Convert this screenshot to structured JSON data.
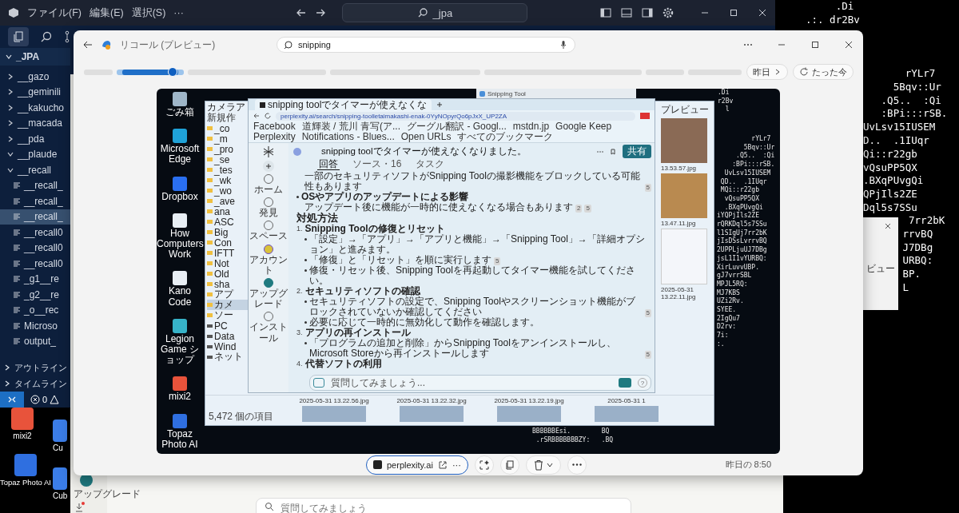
{
  "vscode": {
    "menu": [
      "ファイル(F)",
      "編集(E)",
      "選択(S)",
      "···"
    ],
    "search": "_jpa",
    "root": "_JPA",
    "tree": [
      {
        "label": "__gazo",
        "kind": "folder",
        "expanded": false,
        "selected": false
      },
      {
        "label": "__geminili",
        "kind": "folder",
        "expanded": false,
        "selected": false
      },
      {
        "label": "__kakucho",
        "kind": "folder",
        "expanded": false,
        "selected": false
      },
      {
        "label": "__macada",
        "kind": "folder",
        "expanded": false,
        "selected": false
      },
      {
        "label": "__pda",
        "kind": "folder",
        "expanded": false,
        "selected": false
      },
      {
        "label": "__plaude",
        "kind": "folder",
        "expanded": true,
        "selected": false
      },
      {
        "label": "__recall",
        "kind": "folder",
        "expanded": true,
        "selected": false,
        "children": [
          {
            "label": "__recall_",
            "kind": "file",
            "selected": false
          },
          {
            "label": "__recall_",
            "kind": "file",
            "selected": false
          },
          {
            "label": "__recall_",
            "kind": "file",
            "selected": true
          },
          {
            "label": "__recall0",
            "kind": "file",
            "selected": false
          },
          {
            "label": "__recall0",
            "kind": "file",
            "selected": false
          },
          {
            "label": "__recall0",
            "kind": "file",
            "selected": false
          },
          {
            "label": "_g1__re",
            "kind": "file",
            "selected": false
          },
          {
            "label": "_g2__re",
            "kind": "file",
            "selected": false
          },
          {
            "label": "_o__rec",
            "kind": "file",
            "selected": false
          },
          {
            "label": "Microso",
            "kind": "file",
            "selected": false
          },
          {
            "label": "output_",
            "kind": "file",
            "selected": false
          }
        ]
      }
    ],
    "panels": [
      {
        "label": "アウトライン",
        "expanded": false
      },
      {
        "label": "タイムライン",
        "expanded": false
      }
    ],
    "errors": "0"
  },
  "terminal": {
    "top_lines": [
      "     .Di",
      ".:. dr2Bv"
    ],
    "lines": [
      "       rYLr7",
      "     5Bqv::Ur",
      "   .Q5..  :Qi",
      "   :BPi:::rSB.",
      "UvLsv15IUSEM",
      "D..  .1IUqr",
      "Qi::r22gb",
      "vQsuPP5QX",
      ".BXqPUvgQi",
      "QPjIls2ZE",
      "Dql5s7SSu"
    ],
    "covered_lines": [
      "  7rr2bK",
      " rrvBQ",
      " J7DBg",
      " URBQ:",
      " BP.",
      " L"
    ]
  },
  "side_window": {
    "label": "ビュー"
  },
  "desktop_icons": [
    {
      "label": "mixi2",
      "color": "#e8533b"
    },
    {
      "label": "Cu",
      "color": "#3b7de8"
    },
    {
      "label": "Topaz Photo AI",
      "color": "#2f6fe0"
    },
    {
      "label": "Cub",
      "color": "#3b7de8"
    }
  ],
  "background_app": {
    "upgrade": "アップグレード",
    "placeholder": "質問してみましょう"
  },
  "recall": {
    "title": "リコール (プレビュー)",
    "search": "snipping",
    "timeline": [
      {
        "selected": false
      },
      {
        "selected": true,
        "level": 0.83
      },
      {
        "selected": false
      },
      {
        "selected": false
      },
      {
        "selected": false
      },
      {
        "selected": false
      },
      {
        "selected": false
      }
    ],
    "nav_buttons": [
      {
        "label": "昨日",
        "kind": "prev"
      },
      {
        "label": "たった今",
        "kind": "now"
      }
    ],
    "source": "perplexity.ai",
    "more": "···",
    "time": "昨日の 8:50",
    "snapshot": {
      "desktop_icons": [
        {
          "label": "ごみ箱",
          "color": "#9fb6c8"
        },
        {
          "label": "Microsoft Edge",
          "color": "#1fa2d8"
        },
        {
          "label": "Dropbox",
          "color": "#2a6ff0"
        },
        {
          "label": "How Computers Work",
          "color": "#e8eef4"
        },
        {
          "label": "Kano Code",
          "color": "#e8eef4"
        },
        {
          "label": "Legion Game ショップ",
          "color": "#37b3c8"
        },
        {
          "label": "mixi2",
          "color": "#e8533b"
        },
        {
          "label": "Topaz Photo AI",
          "color": "#2f6fe0"
        }
      ],
      "explorer": {
        "title": "カメラア",
        "new": "新規作",
        "folders": [
          {
            "label": "_co",
            "selected": false
          },
          {
            "label": "_m",
            "selected": false
          },
          {
            "label": "_pro",
            "selected": false
          },
          {
            "label": "_se",
            "selected": false
          },
          {
            "label": "_tes",
            "selected": false
          },
          {
            "label": "_wk",
            "selected": false
          },
          {
            "label": "_wo",
            "selected": false
          },
          {
            "label": "_ave",
            "selected": false
          },
          {
            "label": "ana",
            "selected": false
          },
          {
            "label": "ASC",
            "selected": false
          },
          {
            "label": "Big",
            "selected": false
          },
          {
            "label": "Con",
            "selected": false
          },
          {
            "label": "IFTT",
            "selected": false
          },
          {
            "label": "Not",
            "selected": false
          },
          {
            "label": "Old",
            "selected": false
          },
          {
            "label": "sha",
            "selected": false
          },
          {
            "label": "アプ",
            "selected": false
          },
          {
            "label": "カメ",
            "selected": true
          },
          {
            "label": "ソー",
            "selected": false
          }
        ],
        "drives": [
          {
            "label": "PC",
            "selected": false
          },
          {
            "label": "Data",
            "selected": false
          },
          {
            "label": "Wind",
            "selected": false
          },
          {
            "label": "ネット",
            "selected": false
          }
        ],
        "status": "5,472 個の項目",
        "preview": "プレビュー",
        "side_captions": [
          "13.53.57.jpg",
          "13.47.11.jpg",
          "2025-05-31 13.22.11.jpg"
        ],
        "bottom_captions": [
          "2025-05-31 13.22.56.jpg",
          "2025-05-31 13.22.32.jpg",
          "2025-05-31 13.22.19.jpg",
          "2025-05-31 1"
        ]
      },
      "snipping_title": "Snipping Tool",
      "browser": {
        "tab": "snipping toolでタイマーが使えなくな",
        "url": "perplexity.ai/search/snipping-toolletaimakashi-enak-0YyNOpyrQo6pJxX_UP2ZA",
        "bookmarks": [
          "Facebook",
          "道輝装 / 荒川 青写(ア...",
          "グーグル翻訳 - Googl...",
          "mstdn.jp",
          "Google Keep",
          "Perplexity",
          "Notifications - Blues...",
          "Open URLs",
          "すべてのブックマーク"
        ],
        "rail": [
          "ホーム",
          "発見",
          "スペース",
          "アカウント",
          "アップグレード",
          "インストール"
        ],
        "question": "snipping toolでタイマーが使えなくなりました。",
        "share": "共有",
        "tabs": [
          {
            "label": "回答",
            "selected": true
          },
          {
            "label": "ソース・16",
            "selected": false
          },
          {
            "label": "タスク",
            "selected": false
          }
        ],
        "content": [
          {
            "kind": "para",
            "text": "一部のセキュリティソフトがSnipping Toolの撮影機能をブロックしている可能性もあります",
            "cites": [
              "5"
            ]
          },
          {
            "kind": "bullet",
            "text": "OSやアプリのアップデートによる影響"
          },
          {
            "kind": "para",
            "text": "アップデート後に機能が一時的に使えなくなる場合もあります",
            "cites": [
              "2",
              "5"
            ]
          },
          {
            "kind": "heading",
            "text": "対処方法"
          },
          {
            "kind": "step",
            "num": "1.",
            "text": "Snipping Toolの修復とリセット"
          },
          {
            "kind": "sub",
            "text": "「設定」→「アプリ」→「アプリと機能」→「Snipping Tool」→「詳細オプション」と進みます。"
          },
          {
            "kind": "sub",
            "text": "「修復」と「リセット」を順に実行します",
            "cites": [
              "5"
            ]
          },
          {
            "kind": "sub",
            "text": "修復・リセット後、Snipping Toolを再起動してタイマー機能を試してください。"
          },
          {
            "kind": "step",
            "num": "2.",
            "text": "セキュリティソフトの確認"
          },
          {
            "kind": "sub",
            "text": "セキュリティソフトの設定で、Snipping Toolやスクリーンショット機能がブロックされていないか確認してください",
            "cites": [
              "5"
            ]
          },
          {
            "kind": "sub",
            "text": "必要に応じて一時的に無効化して動作を確認します。"
          },
          {
            "kind": "step",
            "num": "3.",
            "text": "アプリの再インストール"
          },
          {
            "kind": "sub",
            "text": "「プログラムの追加と削除」からSnipping Toolをアンインストールし、Microsoft Storeから再インストールします",
            "cites": [
              "5"
            ]
          },
          {
            "kind": "step",
            "num": "4.",
            "text": "代替ソフトの利用"
          }
        ],
        "placeholder": "質問してみましょう...",
        "help": "?"
      },
      "ascii_top": [
        ".Di",
        "r2Bv",
        "  l"
      ],
      "ascii": [
        "         rYLr7",
        "       5Bqv::Ur",
        "     .Q5..  :Qi",
        "    :BPi:::rSB.",
        "  UvLsv15IUSEM",
        " QD..  .1IUqr",
        " MQi::r22gb",
        "  vQsuPP5QX",
        "  .BXqPUvgQi",
        "iYQPjIls2ZE",
        "rQRKDql5s7SSu",
        "l1SIgUj7rr2bK",
        "jIsDSsLvrrvBQ",
        "2UPPLjuUJ7DBg",
        "jsL1I1vYURBQ:",
        "XirLuvvUBP.",
        "gJ7vrrSBL",
        "MPJL5RQ:",
        "MJ7KBS",
        "UZi2Rv.",
        "SYEE.",
        "2IgQu7",
        "D2rv:",
        "7i:",
        ":."
      ],
      "ascii_bottom": [
        "BBBBBBEsi.        BQ",
        " .rSRBBBBBBBZY:   .BQ"
      ]
    }
  }
}
